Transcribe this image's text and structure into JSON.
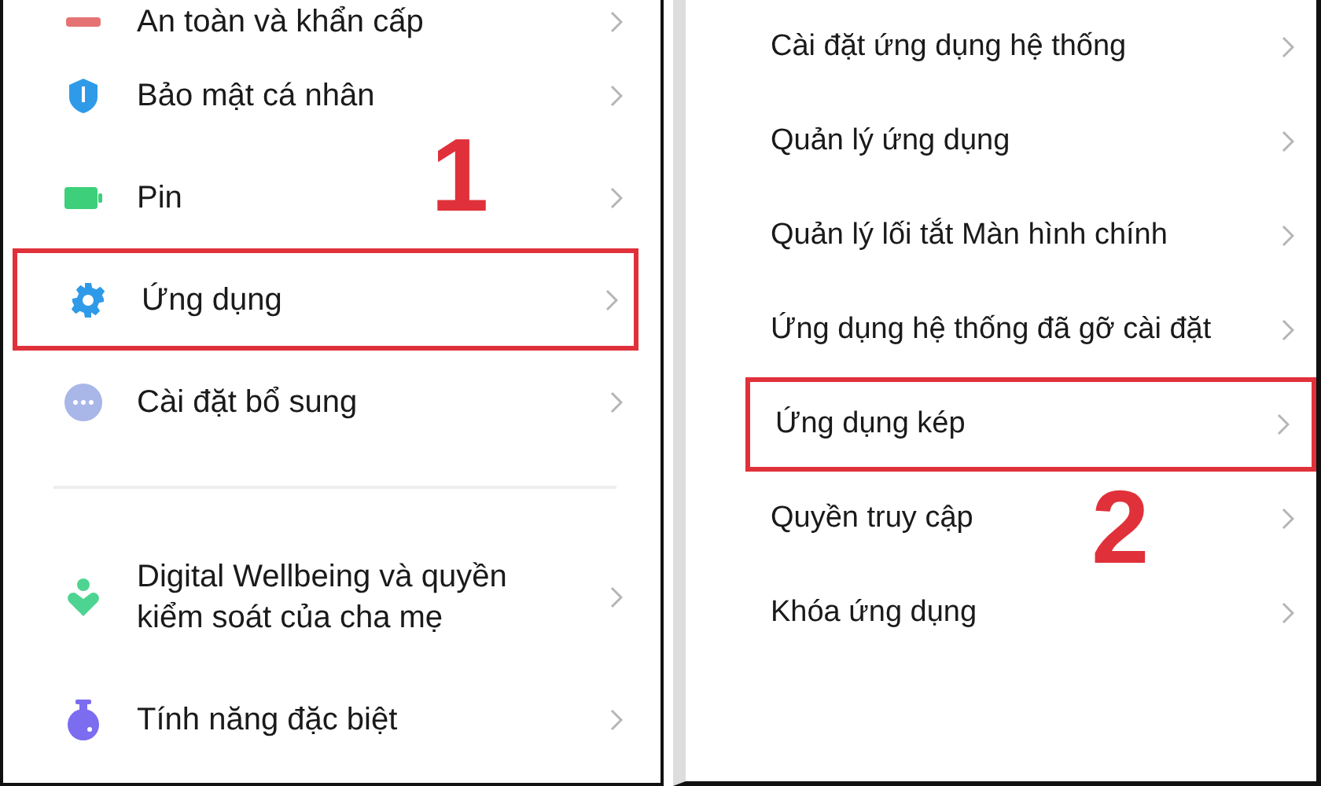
{
  "left_panel": {
    "items": [
      {
        "kind": "safety",
        "label": "An toàn và khẩn cấp",
        "selected": false
      },
      {
        "kind": "shield",
        "label": "Bảo mật cá nhân",
        "selected": false
      },
      {
        "kind": "battery",
        "label": "Pin",
        "selected": false
      },
      {
        "kind": "gear",
        "label": "Ứng dụng",
        "selected": true
      },
      {
        "kind": "dots",
        "label": "Cài đặt bổ sung",
        "selected": false
      },
      {
        "kind": "wellbeing",
        "label": "Digital Wellbeing và quyền kiểm soát của cha mẹ",
        "selected": false
      },
      {
        "kind": "flask",
        "label": "Tính năng đặc biệt",
        "selected": false
      }
    ],
    "step_number": "1"
  },
  "right_panel": {
    "items": [
      {
        "label": "Cài đặt ứng dụng hệ thống",
        "selected": false
      },
      {
        "label": "Quản lý ứng dụng",
        "selected": false
      },
      {
        "label": "Quản lý lối tắt Màn hình chính",
        "selected": false
      },
      {
        "label": "Ứng dụng hệ thống đã gỡ cài đặt",
        "selected": false
      },
      {
        "label": "Ứng dụng kép",
        "selected": true
      },
      {
        "label": "Quyền truy cập",
        "selected": false
      },
      {
        "label": "Khóa ứng dụng",
        "selected": false
      }
    ],
    "step_number": "2"
  }
}
